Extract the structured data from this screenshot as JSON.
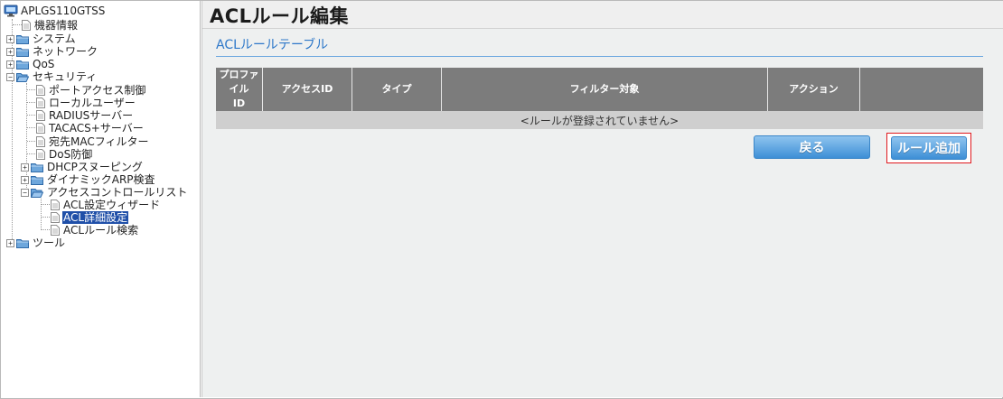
{
  "tree": {
    "root": "APLGS110GTSS",
    "items": {
      "device_info": "機器情報",
      "system": "システム",
      "network": "ネットワーク",
      "qos": "QoS",
      "security": "セキュリティ",
      "port_access": "ポートアクセス制御",
      "local_user": "ローカルユーザー",
      "radius": "RADIUSサーバー",
      "tacacs": "TACACS+サーバー",
      "mac_filter": "宛先MACフィルター",
      "dos": "DoS防御",
      "dhcp_snooping": "DHCPスヌーピング",
      "dynamic_arp": "ダイナミックARP検査",
      "acl_list": "アクセスコントロールリスト",
      "acl_wizard": "ACL設定ウィザード",
      "acl_detail": "ACL詳細設定",
      "acl_search": "ACLルール検索",
      "tools": "ツール"
    },
    "selected_color": "#1f4fa8"
  },
  "main": {
    "page_title": "ACLルール編集",
    "section_title": "ACLルールテーブル",
    "table": {
      "headers": [
        "プロファイル\nID",
        "アクセスID",
        "タイプ",
        "フィルター対象",
        "アクション",
        ""
      ],
      "empty_message": "<ルールが登録されていません>"
    },
    "buttons": {
      "back": "戻る",
      "add_rule": "ルール追加"
    },
    "accent_color": "#2e78c9",
    "highlight_color": "#e0191e"
  }
}
